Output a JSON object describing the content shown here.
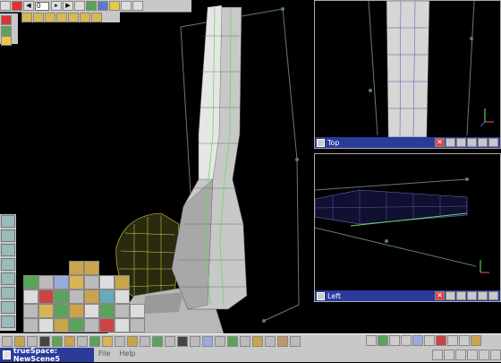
{
  "toolbar": {
    "frame_value": "0"
  },
  "viewports": {
    "top_label": "Top",
    "left_label": "Left"
  },
  "app": {
    "title": "trueSpace: NewScene5"
  },
  "menu": {
    "items": [
      "File",
      "Help"
    ]
  },
  "icons": {
    "play": "play-icon",
    "stop": "stop-icon",
    "close": "close-icon",
    "axis": "axis-gizmo-icon"
  },
  "colors": {
    "viewport_bg": "#000000",
    "titlebar": "#2b3b9a",
    "mesh": "#d0d0d0",
    "wireframe": "#a4d8ff"
  }
}
